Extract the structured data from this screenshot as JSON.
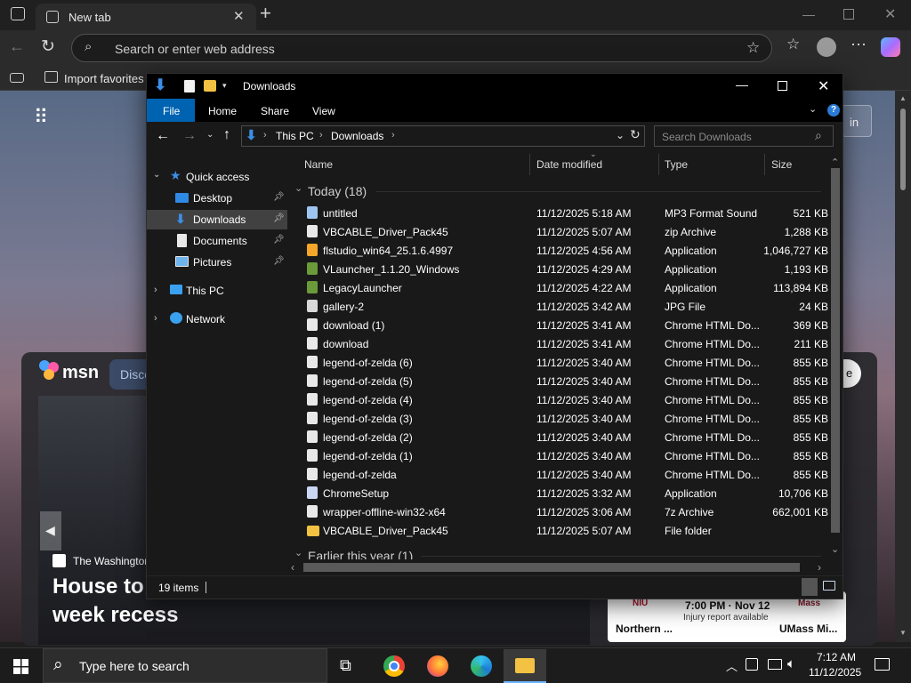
{
  "browser": {
    "tab_title": "New tab",
    "address_placeholder": "Search or enter web address",
    "favorites": {
      "import_label": "Import favorites"
    }
  },
  "msn": {
    "logo_text": "msn",
    "discover_label": "Disco",
    "sign_in_fragment": "in",
    "card_right_fragment": "e",
    "news": {
      "source": "The Washington",
      "headline_line1": "House to",
      "headline_line2": "week recess"
    },
    "sports": {
      "time": "7:00 PM · Nov 12",
      "note": "Injury report available",
      "team_left": "Northern ...",
      "team_right": "UMass Mi...",
      "logo_left": "NIU",
      "logo_right": "Mass"
    }
  },
  "explorer": {
    "title": "Downloads",
    "ribbon_tabs": [
      "File",
      "Home",
      "Share",
      "View"
    ],
    "breadcrumb": [
      "This PC",
      "Downloads"
    ],
    "search_placeholder": "Search Downloads",
    "nav": {
      "quick_access": "Quick access",
      "items": [
        {
          "label": "Desktop",
          "icon": "desktop-icon"
        },
        {
          "label": "Downloads",
          "icon": "downloads-icon"
        },
        {
          "label": "Documents",
          "icon": "documents-icon"
        },
        {
          "label": "Pictures",
          "icon": "pictures-icon"
        }
      ],
      "this_pc": "This PC",
      "network": "Network"
    },
    "columns": {
      "name": "Name",
      "date": "Date modified",
      "type": "Type",
      "size": "Size"
    },
    "groups": {
      "today": "Today (18)",
      "earlier": "Earlier this year (1)"
    },
    "files": [
      {
        "name": "untitled",
        "date": "11/12/2025 5:18 AM",
        "type": "MP3 Format Sound",
        "size": "521 KB",
        "icon": "audio-file-icon"
      },
      {
        "name": "VBCABLE_Driver_Pack45",
        "date": "11/12/2025 5:07 AM",
        "type": "zip Archive",
        "size": "1,288 KB",
        "icon": "zip-file-icon"
      },
      {
        "name": "flstudio_win64_25.1.6.4997",
        "date": "11/12/2025 4:56 AM",
        "type": "Application",
        "size": "1,046,727 KB",
        "icon": "flstudio-app-icon"
      },
      {
        "name": "VLauncher_1.1.20_Windows",
        "date": "11/12/2025 4:29 AM",
        "type": "Application",
        "size": "1,193 KB",
        "icon": "minecraft-block-icon"
      },
      {
        "name": "LegacyLauncher",
        "date": "11/12/2025 4:22 AM",
        "type": "Application",
        "size": "113,894 KB",
        "icon": "minecraft-block-icon"
      },
      {
        "name": "gallery-2",
        "date": "11/12/2025 3:42 AM",
        "type": "JPG File",
        "size": "24 KB",
        "icon": "image-file-icon"
      },
      {
        "name": "download (1)",
        "date": "11/12/2025 3:41 AM",
        "type": "Chrome HTML Do...",
        "size": "369 KB",
        "icon": "chrome-html-file-icon"
      },
      {
        "name": "download",
        "date": "11/12/2025 3:41 AM",
        "type": "Chrome HTML Do...",
        "size": "211 KB",
        "icon": "chrome-html-file-icon"
      },
      {
        "name": "legend-of-zelda (6)",
        "date": "11/12/2025 3:40 AM",
        "type": "Chrome HTML Do...",
        "size": "855 KB",
        "icon": "chrome-html-file-icon"
      },
      {
        "name": "legend-of-zelda (5)",
        "date": "11/12/2025 3:40 AM",
        "type": "Chrome HTML Do...",
        "size": "855 KB",
        "icon": "chrome-html-file-icon"
      },
      {
        "name": "legend-of-zelda (4)",
        "date": "11/12/2025 3:40 AM",
        "type": "Chrome HTML Do...",
        "size": "855 KB",
        "icon": "chrome-html-file-icon"
      },
      {
        "name": "legend-of-zelda (3)",
        "date": "11/12/2025 3:40 AM",
        "type": "Chrome HTML Do...",
        "size": "855 KB",
        "icon": "chrome-html-file-icon"
      },
      {
        "name": "legend-of-zelda (2)",
        "date": "11/12/2025 3:40 AM",
        "type": "Chrome HTML Do...",
        "size": "855 KB",
        "icon": "chrome-html-file-icon"
      },
      {
        "name": "legend-of-zelda (1)",
        "date": "11/12/2025 3:40 AM",
        "type": "Chrome HTML Do...",
        "size": "855 KB",
        "icon": "chrome-html-file-icon"
      },
      {
        "name": "legend-of-zelda",
        "date": "11/12/2025 3:40 AM",
        "type": "Chrome HTML Do...",
        "size": "855 KB",
        "icon": "chrome-html-file-icon"
      },
      {
        "name": "ChromeSetup",
        "date": "11/12/2025 3:32 AM",
        "type": "Application",
        "size": "10,706 KB",
        "icon": "chrome-setup-icon"
      },
      {
        "name": "wrapper-offline-win32-x64",
        "date": "11/12/2025 3:06 AM",
        "type": "7z Archive",
        "size": "662,001 KB",
        "icon": "7z-file-icon"
      },
      {
        "name": "VBCABLE_Driver_Pack45",
        "date": "11/12/2025 5:07 AM",
        "type": "File folder",
        "size": "",
        "icon": "folder-icon"
      }
    ],
    "status": "19 items"
  },
  "taskbar": {
    "search_placeholder": "Type here to search",
    "time": "7:12 AM",
    "date": "11/12/2025"
  },
  "colors": {
    "accent": "#0063b1",
    "selection": "#414141",
    "folder": "#f3c242"
  }
}
